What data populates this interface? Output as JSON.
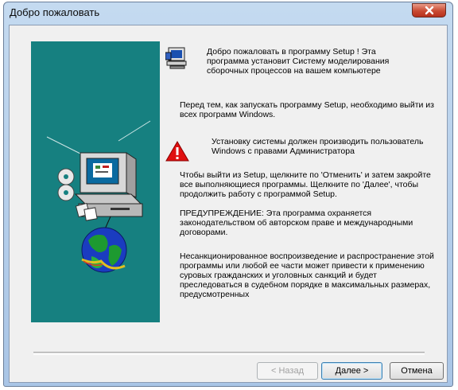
{
  "window": {
    "title": "Добро пожаловать",
    "close_label": "X"
  },
  "intro": {
    "text": "Добро пожаловать в программу Setup ! Эта программа установит Систему моделирования сборочных процессов на вашем компьютере"
  },
  "body": {
    "p1": "Перед тем, как запускать программу Setup, необходимо выйти из всех программ Windows.",
    "warning": "Установку системы должен производить пользователь Windows с правами Администратора",
    "p2": "Чтобы выйти из Setup, щелкните по 'Отменить' и затем закройте все выполняющиеся программы. Щелкните по 'Далее', чтобы продолжить работу с программой Setup.",
    "p3": "ПРЕДУПРЕЖДЕНИЕ: Эта программа охраняется законодательством об авторском праве и международными договорами.",
    "p4": "Несанкционированное воспроизведение и распространение этой программы или любой ее части может привести к применению суровых гражданских и уголовных санкций и будет преследоваться в судебном порядке в максимальных размерах, предусмотренных"
  },
  "buttons": {
    "back": "< Назад",
    "next": "Далее >",
    "cancel": "Отмена"
  },
  "icons": {
    "close": "close-icon",
    "setup": "computer-setup-icon",
    "warning": "warning-icon",
    "illustration": "computer-globe-illustration"
  },
  "colors": {
    "side_panel": "#168080",
    "close_button": "#c94a32",
    "warning": "#e01010"
  }
}
